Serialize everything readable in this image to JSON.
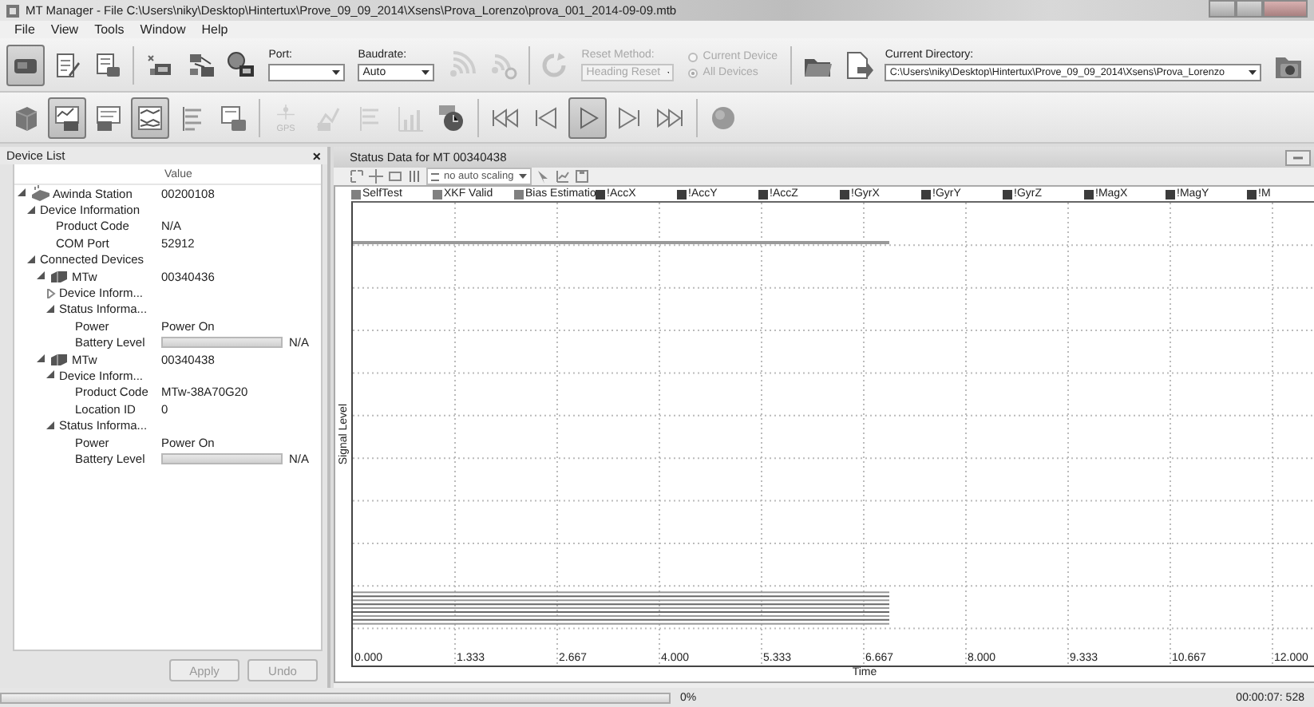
{
  "window": {
    "title": "MT Manager - File C:\\Users\\niky\\Desktop\\Hintertux\\Prove_09_09_2014\\Xsens\\Prova_Lorenzo\\prova_001_2014-09-09.mtb"
  },
  "menu": [
    "File",
    "View",
    "Tools",
    "Window",
    "Help"
  ],
  "main_toolbar": [
    {
      "kind": "button",
      "pressed": true,
      "disabled": false
    },
    {
      "kind": "button",
      "pressed": false,
      "disabled": false
    },
    {
      "kind": "button",
      "pressed": false,
      "disabled": false
    },
    {
      "kind": "separator"
    },
    {
      "kind": "button",
      "pressed": false,
      "disabled": false
    },
    {
      "kind": "button",
      "pressed": false,
      "disabled": false
    },
    {
      "kind": "button",
      "pressed": false,
      "disabled": false
    },
    {
      "kind": "dropdown",
      "label": "Port:",
      "disabled": false
    },
    {
      "kind": "dropdown",
      "label": "Baudrate:",
      "value": "Auto",
      "disabled": false
    },
    {
      "kind": "button",
      "pressed": false,
      "disabled": true
    },
    {
      "kind": "button",
      "pressed": false,
      "disabled": true
    },
    {
      "kind": "separator"
    },
    {
      "kind": "button",
      "pressed": false,
      "disabled": true
    },
    {
      "kind": "dropdown",
      "label": "Reset Method:",
      "value": "Heading Reset",
      "disabled": true
    },
    {
      "kind": "radio_group",
      "disabled": true,
      "options": [
        {
          "label": "Current Device",
          "selected": false
        },
        {
          "label": "All Devices",
          "selected": true
        }
      ]
    },
    {
      "kind": "separator"
    },
    {
      "kind": "button",
      "pressed": false,
      "disabled": false
    },
    {
      "kind": "button",
      "pressed": false,
      "disabled": false
    },
    {
      "kind": "path_field",
      "label": "Current Directory:",
      "value": "C:\\Users\\niky\\Desktop\\Hintertux\\Prove_09_09_2014\\Xsens\\Prova_Lorenzo"
    },
    {
      "kind": "button",
      "pressed": false,
      "disabled": false
    }
  ],
  "view_toolbar": [
    {
      "kind": "button",
      "pressed": false,
      "disabled": false
    },
    {
      "kind": "button",
      "pressed": true,
      "disabled": false
    },
    {
      "kind": "button",
      "pressed": false,
      "disabled": false
    },
    {
      "kind": "button",
      "pressed": true,
      "disabled": false
    },
    {
      "kind": "button",
      "pressed": false,
      "disabled": false
    },
    {
      "kind": "button",
      "pressed": false,
      "disabled": false
    },
    {
      "kind": "separator"
    },
    {
      "kind": "button",
      "label": "GPS",
      "pressed": false,
      "disabled": true
    },
    {
      "kind": "button",
      "pressed": false,
      "disabled": true
    },
    {
      "kind": "button",
      "pressed": false,
      "disabled": true
    },
    {
      "kind": "button",
      "pressed": false,
      "disabled": true
    },
    {
      "kind": "button",
      "pressed": false,
      "disabled": false
    },
    {
      "kind": "separator"
    },
    {
      "kind": "button",
      "pressed": false,
      "disabled": false
    },
    {
      "kind": "button",
      "pressed": false,
      "disabled": false
    },
    {
      "kind": "button",
      "pressed": true,
      "disabled": false
    },
    {
      "kind": "button",
      "pressed": false,
      "disabled": false
    },
    {
      "kind": "button",
      "pressed": false,
      "disabled": false
    },
    {
      "kind": "separator"
    },
    {
      "kind": "button",
      "pressed": false,
      "disabled": false
    }
  ],
  "device_list": {
    "title": "Device List",
    "close": "×",
    "value_header": "Value",
    "tree": [
      {
        "kind": "station",
        "label": "Awinda Station",
        "value": "00200108",
        "expanded": true,
        "children": [
          {
            "kind": "group",
            "label": "Device Information",
            "expanded": true,
            "children": [
              {
                "kind": "field",
                "label": "Product Code",
                "value": "N/A"
              },
              {
                "kind": "field",
                "label": "COM Port",
                "value": "52912"
              }
            ]
          },
          {
            "kind": "group",
            "label": "Connected Devices",
            "expanded": true,
            "children": [
              {
                "kind": "device",
                "label": "MTw",
                "value": "00340436",
                "expanded": true,
                "children": [
                  {
                    "kind": "group",
                    "label": "Device Inform...",
                    "expanded": false
                  },
                  {
                    "kind": "group",
                    "label": "Status Informa...",
                    "expanded": true,
                    "children": [
                      {
                        "kind": "field",
                        "label": "Power",
                        "value": "Power On"
                      },
                      {
                        "kind": "meter",
                        "label": "Battery Level",
                        "level": 0,
                        "value": "N/A"
                      }
                    ]
                  }
                ]
              },
              {
                "kind": "device",
                "label": "MTw",
                "value": "00340438",
                "expanded": true,
                "children": [
                  {
                    "kind": "group",
                    "label": "Device Inform...",
                    "expanded": true,
                    "children": [
                      {
                        "kind": "field",
                        "label": "Product Code",
                        "value": "MTw-38A70G20"
                      },
                      {
                        "kind": "field",
                        "label": "Location ID",
                        "value": "0"
                      }
                    ]
                  },
                  {
                    "kind": "group",
                    "label": "Status Informa...",
                    "expanded": true,
                    "children": [
                      {
                        "kind": "field",
                        "label": "Power",
                        "value": "Power On"
                      },
                      {
                        "kind": "meter",
                        "label": "Battery Level",
                        "level": 0,
                        "value": "N/A"
                      }
                    ]
                  }
                ]
              }
            ]
          }
        ]
      }
    ],
    "buttons": [
      {
        "label": "Apply",
        "disabled": true
      },
      {
        "label": "Undo",
        "disabled": true
      }
    ]
  },
  "status_panel": {
    "title": "Status Data for MT 00340438",
    "scaling": "no auto scaling",
    "legend": [
      {
        "label": "SelfTest",
        "color": "#808080"
      },
      {
        "label": "XKF Valid",
        "color": "#808080"
      },
      {
        "label": "Bias Estimatio",
        "color": "#808080"
      },
      {
        "label": "!AccX",
        "color": "#3c3c3c"
      },
      {
        "label": "!AccY",
        "color": "#3c3c3c"
      },
      {
        "label": "!AccZ",
        "color": "#3c3c3c"
      },
      {
        "label": "!GyrX",
        "color": "#3c3c3c"
      },
      {
        "label": "!GyrY",
        "color": "#3c3c3c"
      },
      {
        "label": "!GyrZ",
        "color": "#3c3c3c"
      },
      {
        "label": "!MagX",
        "color": "#3c3c3c"
      },
      {
        "label": "!MagY",
        "color": "#3c3c3c"
      },
      {
        "label": "!M",
        "color": "#3c3c3c"
      }
    ],
    "ylabel": "Signal Level",
    "xlabel": "Time",
    "x_ticks": [
      "0.000",
      "1.333",
      "2.667",
      "4.000",
      "5.333",
      "6.667",
      "8.000",
      "9.333",
      "10.667",
      "12.000"
    ]
  },
  "status_bar": {
    "level": 0,
    "percent": "0%",
    "time": "00:00:07: 528"
  }
}
